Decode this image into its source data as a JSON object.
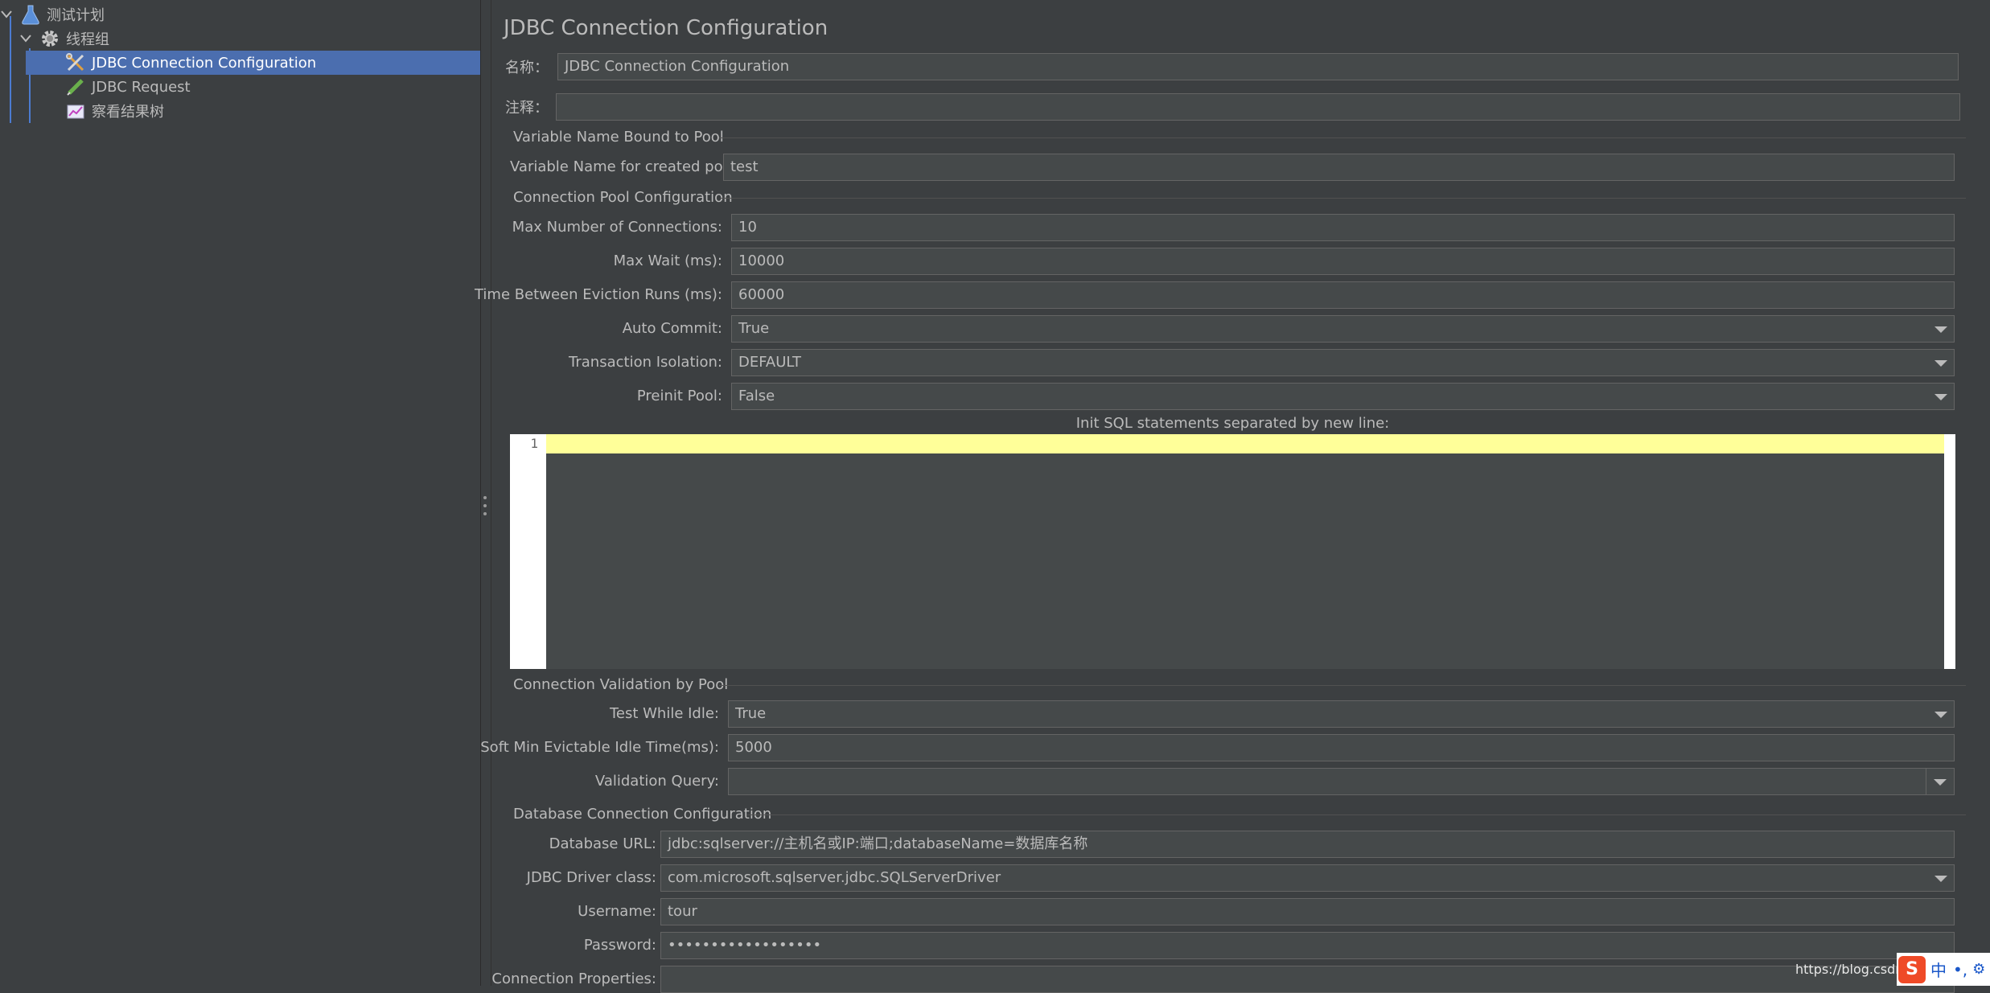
{
  "tree": {
    "items": [
      {
        "label": "测试计划",
        "icon": "test-plan-flask-icon"
      },
      {
        "label": "线程组",
        "icon": "thread-group-gear-icon"
      },
      {
        "label": "JDBC Connection Configuration",
        "icon": "config-wrench-icon",
        "selected": true
      },
      {
        "label": "JDBC Request",
        "icon": "sampler-pen-icon"
      },
      {
        "label": "察看结果树",
        "icon": "listener-chart-icon"
      }
    ]
  },
  "panel": {
    "title": "JDBC Connection Configuration",
    "name_label": "名称：",
    "name_value": "JDBC Connection Configuration",
    "comment_label": "注释：",
    "comment_value": "",
    "sections": {
      "bound": "Variable Name Bound to Pool",
      "pool": "Connection Pool Configuration",
      "validation": "Connection Validation by Pool",
      "database": "Database Connection Configuration"
    },
    "fields": {
      "var_name": {
        "label": "Variable Name for created pool:",
        "value": "test"
      },
      "max_conn": {
        "label": "Max Number of Connections:",
        "value": "10"
      },
      "max_wait": {
        "label": "Max Wait (ms):",
        "value": "10000"
      },
      "eviction": {
        "label": "Time Between Eviction Runs (ms):",
        "value": "60000"
      },
      "auto_commit": {
        "label": "Auto Commit:",
        "value": "True"
      },
      "isolation": {
        "label": "Transaction Isolation:",
        "value": "DEFAULT"
      },
      "preinit": {
        "label": "Preinit Pool:",
        "value": "False"
      },
      "test_idle": {
        "label": "Test While Idle:",
        "value": "True"
      },
      "soft_min": {
        "label": "Soft Min Evictable Idle Time(ms):",
        "value": "5000"
      },
      "validation_query": {
        "label": "Validation Query:",
        "value": ""
      },
      "db_url": {
        "label": "Database URL:",
        "value": "jdbc:sqlserver://主机名或IP:端口;databaseName=数据库名称"
      },
      "driver": {
        "label": "JDBC Driver class:",
        "value": "com.microsoft.sqlserver.jdbc.SQLServerDriver"
      },
      "username": {
        "label": "Username:",
        "value": "tour"
      },
      "password": {
        "label": "Password:",
        "value": "••••••••••••••••••"
      },
      "conn_props": {
        "label": "Connection Properties:",
        "value": ""
      }
    },
    "init_sql": {
      "label": "Init SQL statements separated by new line:",
      "line_number": "1",
      "text": ""
    }
  },
  "overlay": {
    "watermark": "https://blog.csdn.net",
    "ime_logo": "S",
    "ime_mode": "中",
    "ime_punct": "•,",
    "ime_more": "⚙"
  }
}
